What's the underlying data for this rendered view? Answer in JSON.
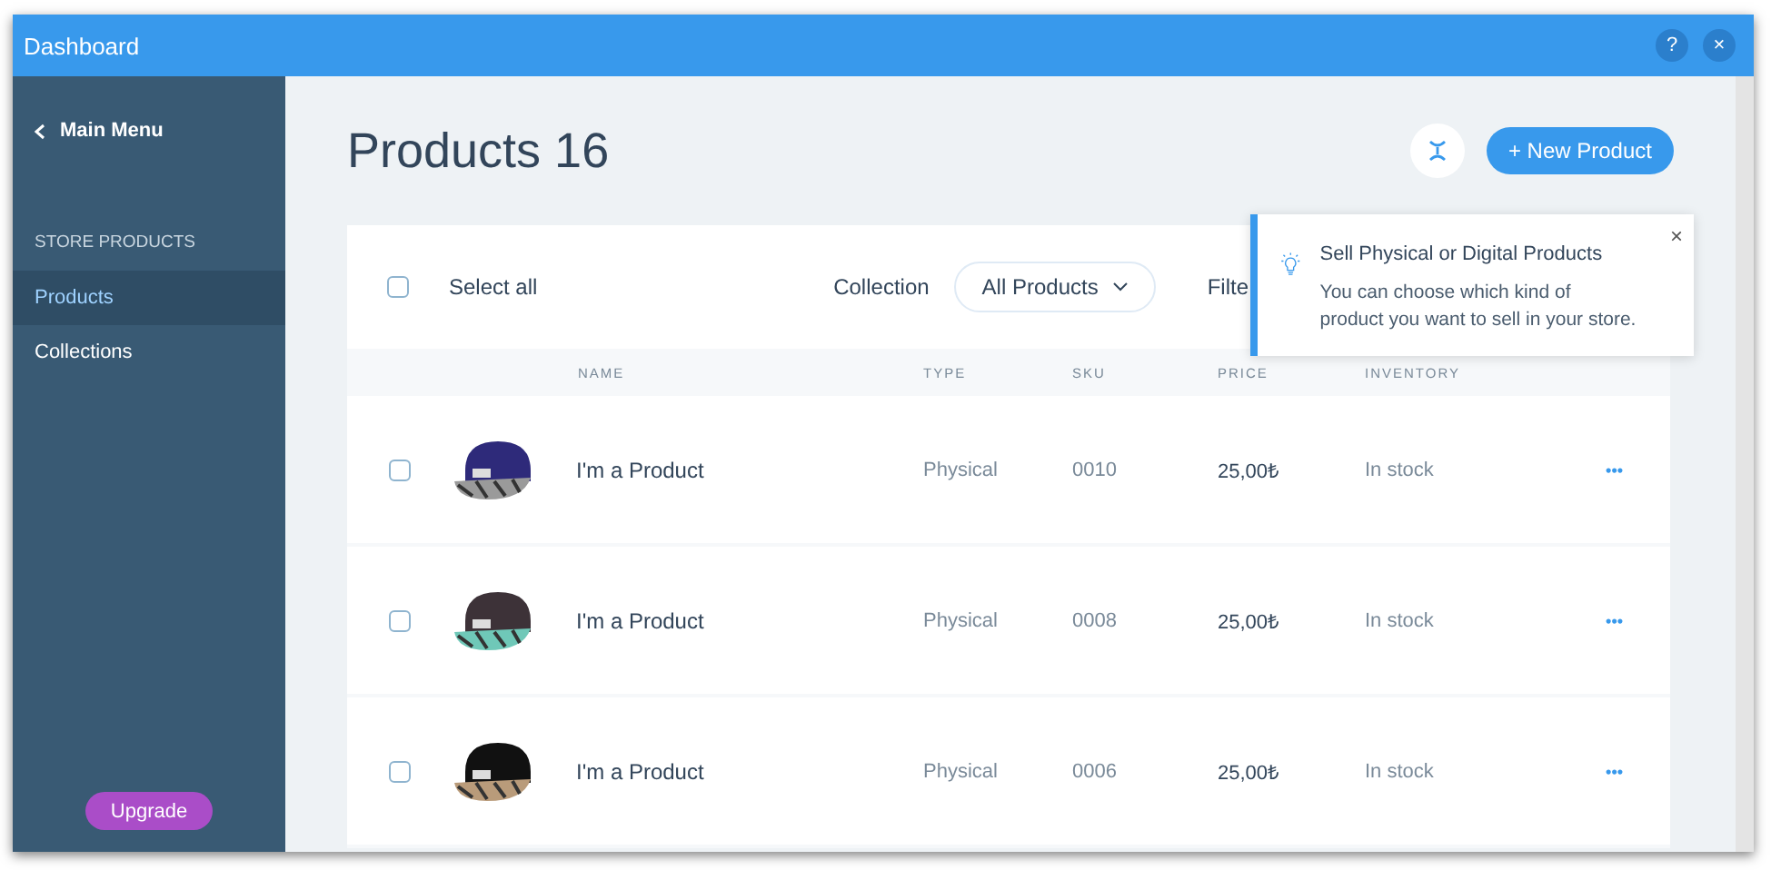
{
  "window": {
    "title": "Dashboard",
    "help": "?",
    "close": "×"
  },
  "sidebar": {
    "back": "Main Menu",
    "section": "STORE PRODUCTS",
    "items": [
      {
        "label": "Products",
        "selected": true
      },
      {
        "label": "Collections",
        "selected": false
      }
    ],
    "upgrade": "Upgrade"
  },
  "header": {
    "title": "Products 16",
    "new_button": "+ New Product"
  },
  "toolbar": {
    "select_all": "Select all",
    "checked": false,
    "collection_label": "Collection",
    "collection_value": "All Products",
    "filter": "Filte"
  },
  "tooltip": {
    "title": "Sell Physical or Digital Products",
    "body": "You can choose which kind of product you want to sell in your store.",
    "close": "×"
  },
  "table": {
    "columns": [
      "NAME",
      "TYPE",
      "SKU",
      "PRICE",
      "INVENTORY"
    ],
    "rows": [
      {
        "checked": false,
        "name": "I'm a Product",
        "type": "Physical",
        "sku": "0010",
        "price": "25,00₺",
        "inventory": "In stock",
        "more": "•••"
      },
      {
        "checked": false,
        "name": "I'm a Product",
        "type": "Physical",
        "sku": "0008",
        "price": "25,00₺",
        "inventory": "In stock",
        "more": "•••"
      },
      {
        "checked": false,
        "name": "I'm a Product",
        "type": "Physical",
        "sku": "0006",
        "price": "25,00₺",
        "inventory": "In stock",
        "more": "•••"
      }
    ]
  }
}
